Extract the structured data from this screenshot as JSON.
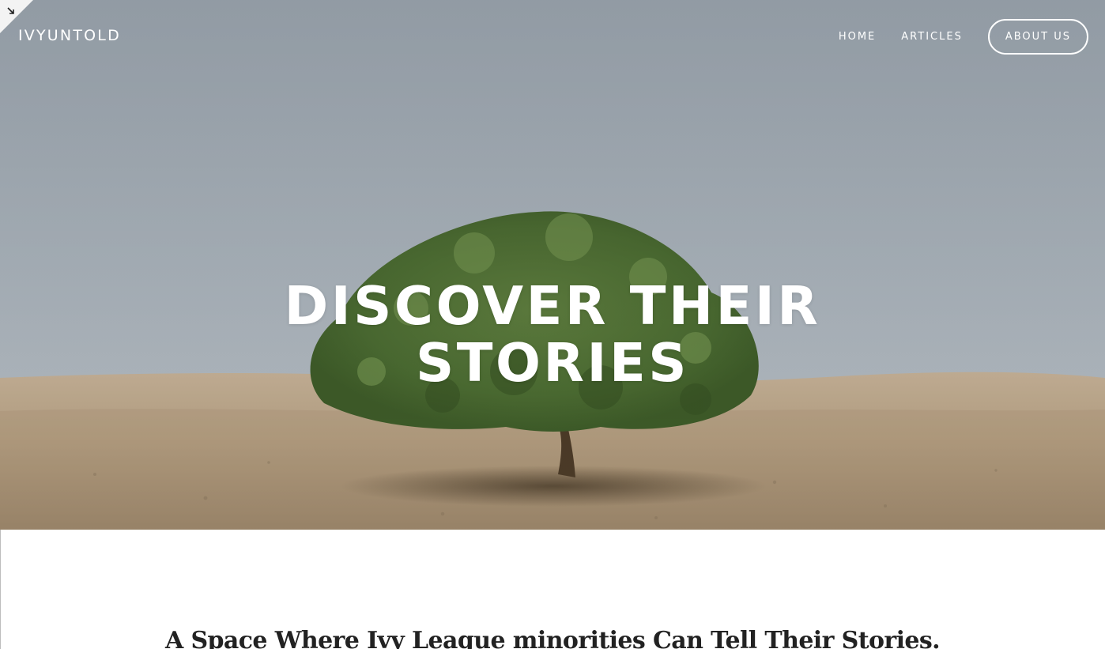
{
  "brand": {
    "name": "IVYUNTOLD"
  },
  "nav": {
    "items": [
      {
        "label": "HOME"
      },
      {
        "label": "ARTICLES"
      },
      {
        "label": "ABOUT US"
      }
    ]
  },
  "hero": {
    "title_line1": "DISCOVER THEIR",
    "title_line2": "STORIES",
    "image_subject": "lone-tree-in-desert"
  },
  "intro": {
    "tagline": "A Space Where Ivy League minorities Can Tell Their Stories."
  },
  "colors": {
    "sky": "#a3adb6",
    "sand": "#b6a185",
    "tree": "#4f6e35",
    "text_dark": "#222222",
    "white": "#ffffff"
  }
}
